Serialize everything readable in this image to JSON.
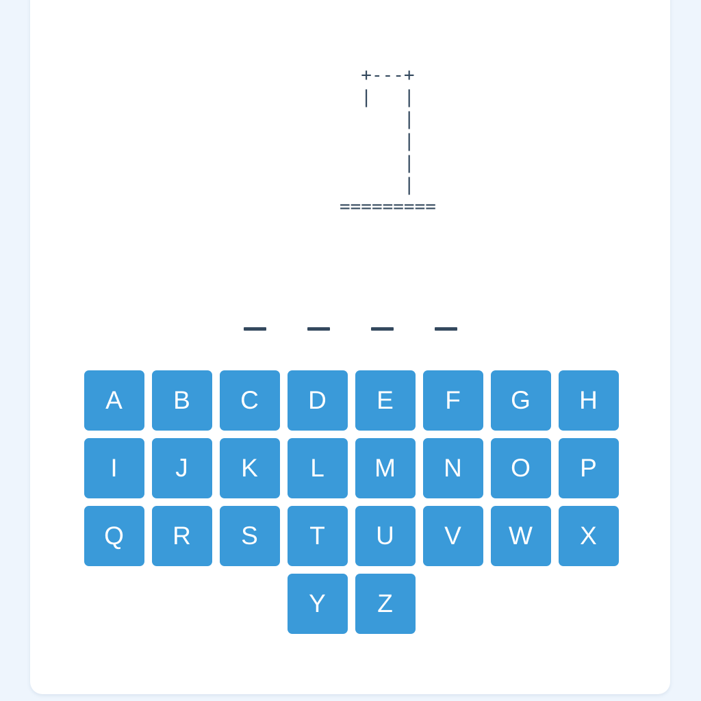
{
  "game": {
    "gallows_art": "  +---+\n  |   |\n      |\n      |\n      |\n      |\n=========",
    "word_slots": [
      "_",
      "_",
      "_",
      "_"
    ]
  },
  "keyboard": {
    "keys": [
      "A",
      "B",
      "C",
      "D",
      "E",
      "F",
      "G",
      "H",
      "I",
      "J",
      "K",
      "L",
      "M",
      "N",
      "O",
      "P",
      "Q",
      "R",
      "S",
      "T",
      "U",
      "V",
      "W",
      "X",
      "Y",
      "Z"
    ]
  },
  "colors": {
    "key_background": "#3a9ad9",
    "key_text": "#ffffff",
    "ink": "#34495e",
    "page_background": "#eef5fd",
    "card_background": "#ffffff"
  }
}
